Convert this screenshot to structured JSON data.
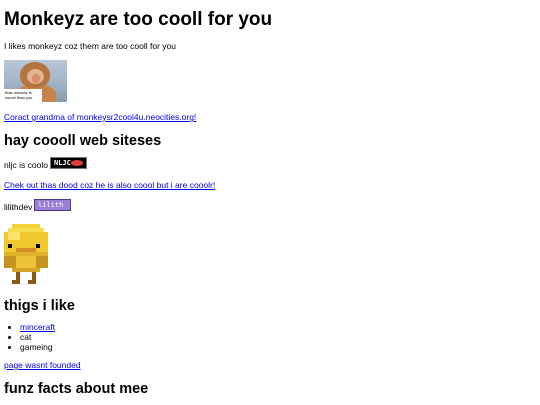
{
  "page": {
    "title": "Monkeyz are too cooll for you",
    "intro": "I likes monkeyz coz them are too cooll for you",
    "monkey_caption": "thas monkey is cooolr than you",
    "grandma_link": "Coract grandma of monkeysr2cool4u.neocities.org!",
    "sites_heading": "hay coooll web siteses",
    "nljc_label": "nljc is coolo",
    "nljc_button_text": "NLJC",
    "chek_link": "Chek out thas dood coz he is also coool but i are cooolr!",
    "lilith_label": "lilithdev",
    "lilith_button_text": "lilith",
    "likes_heading": "thigs i like",
    "likes": [
      "minceraft",
      "cat",
      "gameing"
    ],
    "not_found_link": "page wasnt founded",
    "facts_heading": "funz facts about mee"
  },
  "colors": {
    "link": "#0000ee",
    "text": "#000000",
    "background": "#ffffff"
  }
}
